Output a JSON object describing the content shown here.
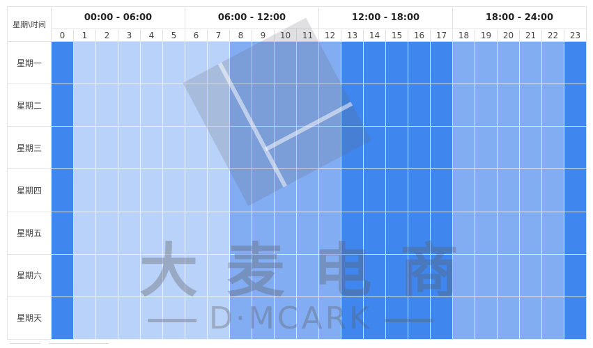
{
  "corner_label": "星期\\时间",
  "groups": [
    "00:00 - 06:00",
    "06:00 - 12:00",
    "12:00 - 18:00",
    "18:00 - 24:00"
  ],
  "hours": [
    "0",
    "1",
    "2",
    "3",
    "4",
    "5",
    "6",
    "7",
    "8",
    "9",
    "10",
    "11",
    "12",
    "13",
    "14",
    "15",
    "16",
    "17",
    "18",
    "19",
    "20",
    "21",
    "22",
    "23"
  ],
  "days": [
    "星期一",
    "星期二",
    "星期三",
    "星期四",
    "星期五",
    "星期六",
    "星期天"
  ],
  "colors": {
    "dark": "#3f86ee",
    "medium": "#82adf3",
    "light": "#b8d2f9"
  },
  "hour_levels": [
    "dark",
    "light",
    "light",
    "light",
    "light",
    "light",
    "light",
    "light",
    "medium",
    "medium",
    "medium",
    "medium",
    "medium",
    "dark",
    "dark",
    "dark",
    "dark",
    "dark",
    "medium",
    "medium",
    "medium",
    "medium",
    "medium",
    "dark"
  ],
  "watermark": {
    "title": [
      "大",
      "麦",
      "电",
      "商"
    ],
    "subtitle": "D·MCARK"
  }
}
